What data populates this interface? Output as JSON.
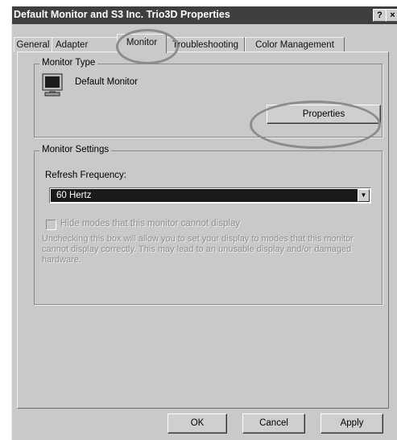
{
  "window": {
    "title": "Default Monitor and S3 Inc. Trio3D Properties",
    "help_glyph": "?",
    "close_glyph": "×"
  },
  "tabs": [
    {
      "label": "General"
    },
    {
      "label": "Adapter"
    },
    {
      "label": "Monitor",
      "active": true
    },
    {
      "label": "Troubleshooting"
    },
    {
      "label": "Color Management"
    }
  ],
  "monitor_type": {
    "legend": "Monitor Type",
    "device_name": "Default Monitor",
    "properties_label": "Properties"
  },
  "monitor_settings": {
    "legend": "Monitor Settings",
    "refresh_label": "Refresh Frequency:",
    "refresh_value": "60 Hertz",
    "hide_modes_label": "Hide modes that this monitor cannot display",
    "hide_modes_checked": false,
    "hide_modes_enabled": false,
    "warning_text": "Unchecking this box will allow you to set your display to modes that this monitor cannot display correctly. This may lead to an unusable display and/or damaged hardware."
  },
  "buttons": {
    "ok": "OK",
    "cancel": "Cancel",
    "apply": "Apply"
  },
  "annotations": {
    "highlight_color": "#8c8c8c"
  },
  "icons": {
    "monitor": "monitor-icon",
    "dropdown": "dropdown-arrow-icon"
  }
}
